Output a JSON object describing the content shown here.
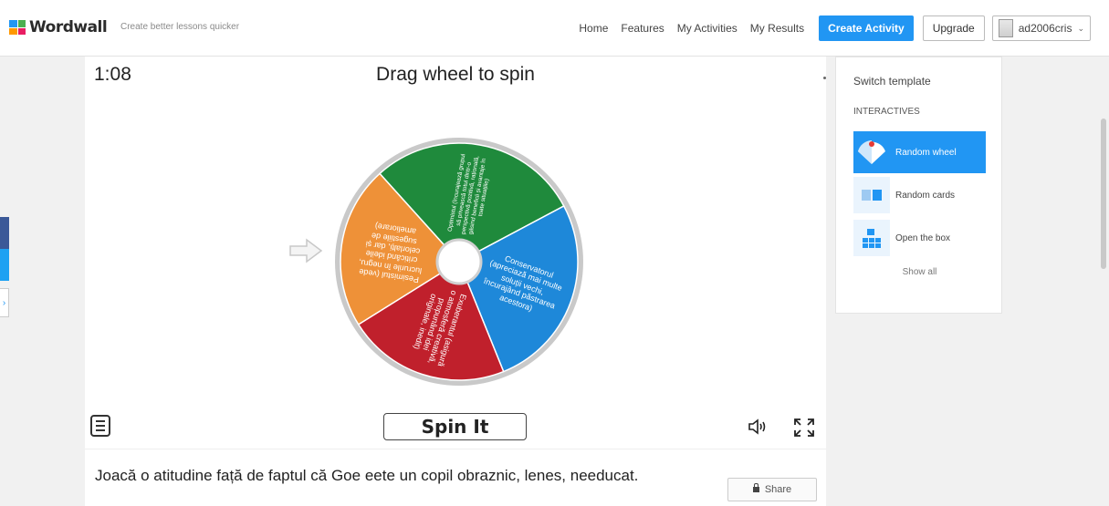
{
  "header": {
    "logo_text": "Wordwall",
    "tagline": "Create better lessons quicker",
    "nav": [
      "Home",
      "Features",
      "My Activities",
      "My Results"
    ],
    "create_label": "Create Activity",
    "upgrade_label": "Upgrade",
    "username": "ad2006cris"
  },
  "game": {
    "timer": "1:08",
    "title": "Drag wheel to spin",
    "spin_label": "Spin It",
    "segments": [
      {
        "text": "Optimistul (încurajează grupul să privească totul dintr-o perspectivă pozitivă, rațională, găsind beneficii și avantaje în toate situațiile)",
        "color": "#1f8a3c"
      },
      {
        "text": "Conservatorul (apreciază mai multe soluții vechi, încurajând păstrarea acestora)",
        "color": "#1e88d9"
      },
      {
        "text": "Exuberantul (asigură o atmosferă creativă, propunând idei originale, inedit)",
        "color": "#c0202c"
      },
      {
        "text": "Pesimistul (vede lucrurile în negru, criticând ideile celorlalți, dar și sugestiile de ameliorare)",
        "color": "#ee9138"
      }
    ]
  },
  "description": {
    "text": "Joacă o atitudine față de faptul că Goe eete un copil obraznic, lenes, needucat.",
    "share_label": "Share"
  },
  "side": {
    "title": "Switch template",
    "subtitle": "INTERACTIVES",
    "templates": [
      {
        "label": "Random wheel",
        "icon": "wheel-icon"
      },
      {
        "label": "Random cards",
        "icon": "cards-icon"
      },
      {
        "label": "Open the box",
        "icon": "box-icon"
      }
    ],
    "show_all": "Show all"
  },
  "colors": {
    "accent": "#2196f3"
  }
}
